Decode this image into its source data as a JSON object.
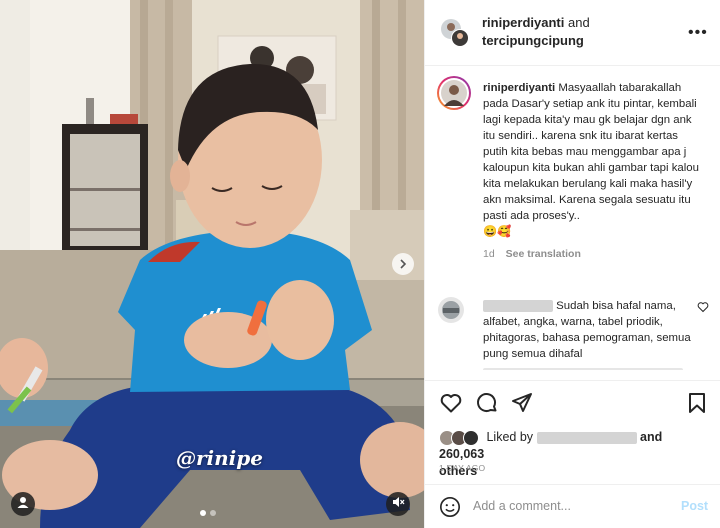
{
  "post": {
    "watermark": "@rinipe",
    "carousel": {
      "count": 2,
      "active": 1
    },
    "icons": {
      "next": "chevron-right-icon",
      "tag": "user-icon",
      "mute": "speaker-muted-icon"
    }
  },
  "header": {
    "user1": "riniperdiyanti",
    "and_text": "and",
    "user2": "tercipungcipung",
    "more_icon": "more-horizontal-icon",
    "more_glyph": "•••"
  },
  "caption": {
    "username": "riniperdiyanti",
    "text": "Masyaallah tabarakallah pada Dasar'y setiap ank itu pintar, kembali lagi kepada kita'y mau gk belajar dgn ank itu sendiri.. karena snk itu ibarat kertas putih kita bebas mau menggambar apa j kaloupun kita bukan ahli gambar tapi kalou kita melakukan berulang kali maka hasil'y akn maksimal. Karena segala sesuatu itu pasti ada proses'y..",
    "emojis": "😀🥰",
    "age": "1d",
    "see_translation": "See translation"
  },
  "comment": {
    "text": "Sudah bisa hafal nama, alfabet, angka, warna, tabel priodik, phitagoras, bahasa pemograman, semua pung semua dihafal"
  },
  "actions": {
    "icons": [
      "heart-icon",
      "comment-icon",
      "share-icon",
      "bookmark-icon"
    ],
    "liked_by": "Liked by",
    "and_count": "and 260,063",
    "others": "others",
    "date": "1 DAY AGO"
  },
  "add_comment": {
    "placeholder": "Add a comment...",
    "post_label": "Post"
  },
  "colors": {
    "accent_disabled": "#b2dffc",
    "text": "#262626",
    "muted": "#8e8e8e",
    "border": "#efefef"
  }
}
